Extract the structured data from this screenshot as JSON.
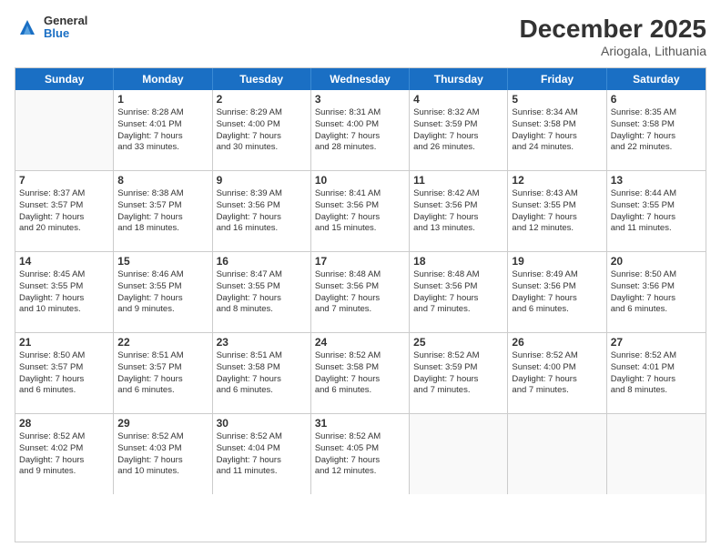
{
  "header": {
    "logo_general": "General",
    "logo_blue": "Blue",
    "title": "December 2025",
    "subtitle": "Ariogala, Lithuania"
  },
  "calendar": {
    "days_of_week": [
      "Sunday",
      "Monday",
      "Tuesday",
      "Wednesday",
      "Thursday",
      "Friday",
      "Saturday"
    ],
    "weeks": [
      [
        {
          "day": "",
          "info": ""
        },
        {
          "day": "1",
          "info": "Sunrise: 8:28 AM\nSunset: 4:01 PM\nDaylight: 7 hours\nand 33 minutes."
        },
        {
          "day": "2",
          "info": "Sunrise: 8:29 AM\nSunset: 4:00 PM\nDaylight: 7 hours\nand 30 minutes."
        },
        {
          "day": "3",
          "info": "Sunrise: 8:31 AM\nSunset: 4:00 PM\nDaylight: 7 hours\nand 28 minutes."
        },
        {
          "day": "4",
          "info": "Sunrise: 8:32 AM\nSunset: 3:59 PM\nDaylight: 7 hours\nand 26 minutes."
        },
        {
          "day": "5",
          "info": "Sunrise: 8:34 AM\nSunset: 3:58 PM\nDaylight: 7 hours\nand 24 minutes."
        },
        {
          "day": "6",
          "info": "Sunrise: 8:35 AM\nSunset: 3:58 PM\nDaylight: 7 hours\nand 22 minutes."
        }
      ],
      [
        {
          "day": "7",
          "info": "Sunrise: 8:37 AM\nSunset: 3:57 PM\nDaylight: 7 hours\nand 20 minutes."
        },
        {
          "day": "8",
          "info": "Sunrise: 8:38 AM\nSunset: 3:57 PM\nDaylight: 7 hours\nand 18 minutes."
        },
        {
          "day": "9",
          "info": "Sunrise: 8:39 AM\nSunset: 3:56 PM\nDaylight: 7 hours\nand 16 minutes."
        },
        {
          "day": "10",
          "info": "Sunrise: 8:41 AM\nSunset: 3:56 PM\nDaylight: 7 hours\nand 15 minutes."
        },
        {
          "day": "11",
          "info": "Sunrise: 8:42 AM\nSunset: 3:56 PM\nDaylight: 7 hours\nand 13 minutes."
        },
        {
          "day": "12",
          "info": "Sunrise: 8:43 AM\nSunset: 3:55 PM\nDaylight: 7 hours\nand 12 minutes."
        },
        {
          "day": "13",
          "info": "Sunrise: 8:44 AM\nSunset: 3:55 PM\nDaylight: 7 hours\nand 11 minutes."
        }
      ],
      [
        {
          "day": "14",
          "info": "Sunrise: 8:45 AM\nSunset: 3:55 PM\nDaylight: 7 hours\nand 10 minutes."
        },
        {
          "day": "15",
          "info": "Sunrise: 8:46 AM\nSunset: 3:55 PM\nDaylight: 7 hours\nand 9 minutes."
        },
        {
          "day": "16",
          "info": "Sunrise: 8:47 AM\nSunset: 3:55 PM\nDaylight: 7 hours\nand 8 minutes."
        },
        {
          "day": "17",
          "info": "Sunrise: 8:48 AM\nSunset: 3:56 PM\nDaylight: 7 hours\nand 7 minutes."
        },
        {
          "day": "18",
          "info": "Sunrise: 8:48 AM\nSunset: 3:56 PM\nDaylight: 7 hours\nand 7 minutes."
        },
        {
          "day": "19",
          "info": "Sunrise: 8:49 AM\nSunset: 3:56 PM\nDaylight: 7 hours\nand 6 minutes."
        },
        {
          "day": "20",
          "info": "Sunrise: 8:50 AM\nSunset: 3:56 PM\nDaylight: 7 hours\nand 6 minutes."
        }
      ],
      [
        {
          "day": "21",
          "info": "Sunrise: 8:50 AM\nSunset: 3:57 PM\nDaylight: 7 hours\nand 6 minutes."
        },
        {
          "day": "22",
          "info": "Sunrise: 8:51 AM\nSunset: 3:57 PM\nDaylight: 7 hours\nand 6 minutes."
        },
        {
          "day": "23",
          "info": "Sunrise: 8:51 AM\nSunset: 3:58 PM\nDaylight: 7 hours\nand 6 minutes."
        },
        {
          "day": "24",
          "info": "Sunrise: 8:52 AM\nSunset: 3:58 PM\nDaylight: 7 hours\nand 6 minutes."
        },
        {
          "day": "25",
          "info": "Sunrise: 8:52 AM\nSunset: 3:59 PM\nDaylight: 7 hours\nand 7 minutes."
        },
        {
          "day": "26",
          "info": "Sunrise: 8:52 AM\nSunset: 4:00 PM\nDaylight: 7 hours\nand 7 minutes."
        },
        {
          "day": "27",
          "info": "Sunrise: 8:52 AM\nSunset: 4:01 PM\nDaylight: 7 hours\nand 8 minutes."
        }
      ],
      [
        {
          "day": "28",
          "info": "Sunrise: 8:52 AM\nSunset: 4:02 PM\nDaylight: 7 hours\nand 9 minutes."
        },
        {
          "day": "29",
          "info": "Sunrise: 8:52 AM\nSunset: 4:03 PM\nDaylight: 7 hours\nand 10 minutes."
        },
        {
          "day": "30",
          "info": "Sunrise: 8:52 AM\nSunset: 4:04 PM\nDaylight: 7 hours\nand 11 minutes."
        },
        {
          "day": "31",
          "info": "Sunrise: 8:52 AM\nSunset: 4:05 PM\nDaylight: 7 hours\nand 12 minutes."
        },
        {
          "day": "",
          "info": ""
        },
        {
          "day": "",
          "info": ""
        },
        {
          "day": "",
          "info": ""
        }
      ]
    ]
  }
}
